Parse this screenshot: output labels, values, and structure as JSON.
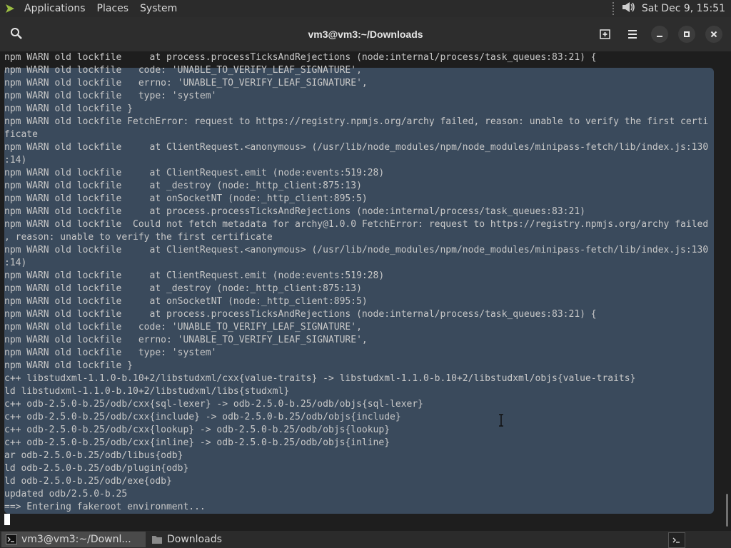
{
  "top_panel": {
    "menus": [
      "Applications",
      "Places",
      "System"
    ],
    "clock": "Sat Dec 9, 15:51",
    "apps_icon": "arch-logo-icon",
    "volume_icon": "volume-icon"
  },
  "window": {
    "title": "vm3@vm3:~/Downloads",
    "search_icon": "search-icon",
    "new_tab_icon": "new-tab-icon",
    "menu_icon": "hamburger-menu-icon"
  },
  "terminal": {
    "lines": [
      "npm WARN old lockfile     at process.processTicksAndRejections (node:internal/process/task_queues:83:21) {",
      "npm WARN old lockfile   code: 'UNABLE_TO_VERIFY_LEAF_SIGNATURE',",
      "npm WARN old lockfile   errno: 'UNABLE_TO_VERIFY_LEAF_SIGNATURE',",
      "npm WARN old lockfile   type: 'system'",
      "npm WARN old lockfile }",
      "npm WARN old lockfile FetchError: request to https://registry.npmjs.org/archy failed, reason: unable to verify the first certi",
      "ficate",
      "npm WARN old lockfile     at ClientRequest.<anonymous> (/usr/lib/node_modules/npm/node_modules/minipass-fetch/lib/index.js:130",
      ":14)",
      "npm WARN old lockfile     at ClientRequest.emit (node:events:519:28)",
      "npm WARN old lockfile     at _destroy (node:_http_client:875:13)",
      "npm WARN old lockfile     at onSocketNT (node:_http_client:895:5)",
      "npm WARN old lockfile     at process.processTicksAndRejections (node:internal/process/task_queues:83:21)",
      "npm WARN old lockfile  Could not fetch metadata for archy@1.0.0 FetchError: request to https://registry.npmjs.org/archy failed",
      ", reason: unable to verify the first certificate",
      "npm WARN old lockfile     at ClientRequest.<anonymous> (/usr/lib/node_modules/npm/node_modules/minipass-fetch/lib/index.js:130",
      ":14)",
      "npm WARN old lockfile     at ClientRequest.emit (node:events:519:28)",
      "npm WARN old lockfile     at _destroy (node:_http_client:875:13)",
      "npm WARN old lockfile     at onSocketNT (node:_http_client:895:5)",
      "npm WARN old lockfile     at process.processTicksAndRejections (node:internal/process/task_queues:83:21) {",
      "npm WARN old lockfile   code: 'UNABLE_TO_VERIFY_LEAF_SIGNATURE',",
      "npm WARN old lockfile   errno: 'UNABLE_TO_VERIFY_LEAF_SIGNATURE',",
      "npm WARN old lockfile   type: 'system'",
      "npm WARN old lockfile }",
      "c++ libstudxml-1.1.0-b.10+2/libstudxml/cxx{value-traits} -> libstudxml-1.1.0-b.10+2/libstudxml/objs{value-traits}",
      "ld libstudxml-1.1.0-b.10+2/libstudxml/libs{studxml}",
      "c++ odb-2.5.0-b.25/odb/cxx{sql-lexer} -> odb-2.5.0-b.25/odb/objs{sql-lexer}",
      "c++ odb-2.5.0-b.25/odb/cxx{include} -> odb-2.5.0-b.25/odb/objs{include}",
      "c++ odb-2.5.0-b.25/odb/cxx{lookup} -> odb-2.5.0-b.25/odb/objs{lookup}",
      "c++ odb-2.5.0-b.25/odb/cxx{inline} -> odb-2.5.0-b.25/odb/objs{inline}",
      "ar odb-2.5.0-b.25/odb/libus{odb}",
      "ld odb-2.5.0-b.25/odb/plugin{odb}",
      "ld odb-2.5.0-b.25/odb/exe{odb}",
      "updated odb/2.5.0-b.25",
      "==> Entering fakeroot environment..."
    ]
  },
  "taskbar": {
    "tasks": [
      {
        "label": "vm3@vm3:~/Downl...",
        "icon": "terminal-icon"
      },
      {
        "label": "Downloads",
        "icon": "folder-icon"
      }
    ],
    "tray_icon": "terminal-tray-icon"
  },
  "colors": {
    "terminal_bg": "#1e1e1e",
    "selection_bg": "#3a4a5c",
    "terminal_fg": "#c8c8c8",
    "panel_bg": "#2b2b2b"
  }
}
